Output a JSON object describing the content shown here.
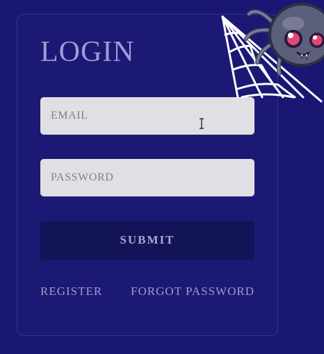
{
  "login_form": {
    "title": "LOGIN",
    "email": {
      "placeholder": "EMAIL",
      "value": ""
    },
    "password": {
      "placeholder": "PASSWORD",
      "value": ""
    },
    "submit_label": "SUBMIT",
    "register_label": "REGISTER",
    "forgot_label": "FORGOT PASSWORD"
  },
  "decor": {
    "mascot_icon": "spider-on-web-icon",
    "cursor_icon": "text-cursor-icon"
  },
  "colors": {
    "background": "#1a1772",
    "title": "#9f9bd8",
    "input_bg": "#e0e0e4",
    "submit_bg": "#131457",
    "link": "#9d9ccf"
  }
}
